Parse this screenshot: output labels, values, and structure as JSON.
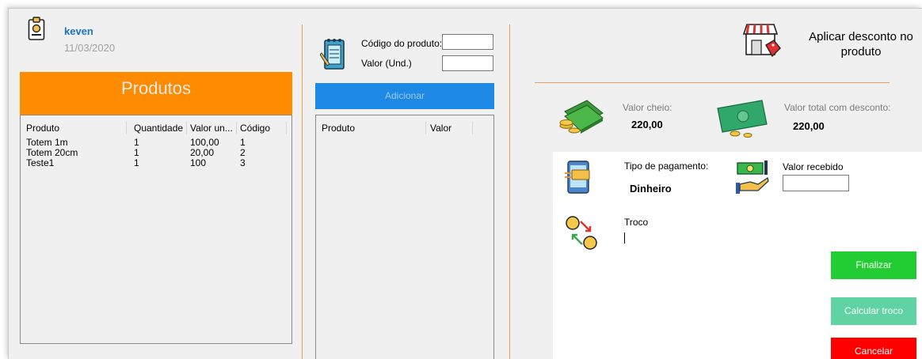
{
  "user": {
    "name": "keven",
    "date": "11/03/2020"
  },
  "produtos": {
    "title": "Produtos",
    "columns": [
      "Produto",
      "Quantidade",
      "Valor un...",
      "Código"
    ],
    "rows": [
      [
        "Totem 1m",
        "1",
        "100,00",
        "1"
      ],
      [
        "Totem 20cm",
        "1",
        "20,00",
        "2"
      ],
      [
        "Teste1",
        "1",
        "100",
        "3"
      ]
    ]
  },
  "form": {
    "codigo_label": "Código do produto:",
    "valor_label": "Valor (Und.)",
    "codigo_value": "",
    "valor_value": "",
    "add_button": "Adicionar"
  },
  "carrinho": {
    "columns": [
      "Produto",
      "Valor"
    ]
  },
  "desconto": {
    "label": "Aplicar desconto no produto"
  },
  "valores": {
    "cheio_label": "Valor cheio:",
    "cheio_value": "220,00",
    "total_label": "Valor total com desconto:",
    "total_value": "220,00"
  },
  "pagamento": {
    "tipo_label": "Tipo de pagamento:",
    "tipo_value": "Dinheiro",
    "recebido_label": "Valor recebido",
    "recebido_value": "",
    "troco_label": "Troco",
    "troco_value": ""
  },
  "buttons": {
    "finalizar": "Finalizar",
    "calcular": "Calcular troco",
    "cancelar": "Cancelar"
  },
  "colors": {
    "accent_orange": "#ff8c00",
    "blue": "#1e88e5",
    "green": "#22cc33",
    "teal": "#5fd3a2",
    "red": "#ff0000",
    "username": "#1a73c8"
  },
  "icons": [
    "badge-icon",
    "notepad-icon",
    "store-icon",
    "money-stack-icon",
    "cash-bill-icon",
    "phone-payment-icon",
    "hand-cash-icon",
    "exchange-coins-icon"
  ]
}
